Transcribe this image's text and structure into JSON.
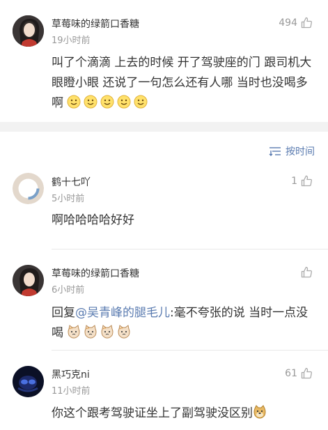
{
  "post": {
    "user": "草莓味的绿箭口香糖",
    "time": "19小时前",
    "likes": "494",
    "text": "叫了个滴滴 上去的时候 开了驾驶座的门 跟司机大眼瞪小眼  还说了一句怎么还有人哪  当时也没喝多啊"
  },
  "sort": {
    "label": "按时间"
  },
  "comments": [
    {
      "user": "鹤十七吖",
      "time": "5小时前",
      "likes": "1",
      "text": "啊哈哈哈哈好好"
    },
    {
      "user": "草莓味的绿箭口香糖",
      "time": "6小时前",
      "likes": "",
      "reply_prefix": "回复",
      "mention": "@吴青峰的腿毛儿",
      "text": ":毫不夸张的说  当时一点没喝"
    },
    {
      "user": "黑巧克ni",
      "time": "11小时前",
      "likes": "61",
      "text": "你这个跟考驾驶证坐上了副驾驶没区别"
    }
  ],
  "colors": {
    "link": "#5a7bb0",
    "meta": "#999999",
    "text": "#333333",
    "separator": "#f2f2f2"
  },
  "icons": [
    "thumbs-up-icon",
    "sort-icon",
    "smile-emoji",
    "cat-emoji",
    "doge-emoji"
  ]
}
